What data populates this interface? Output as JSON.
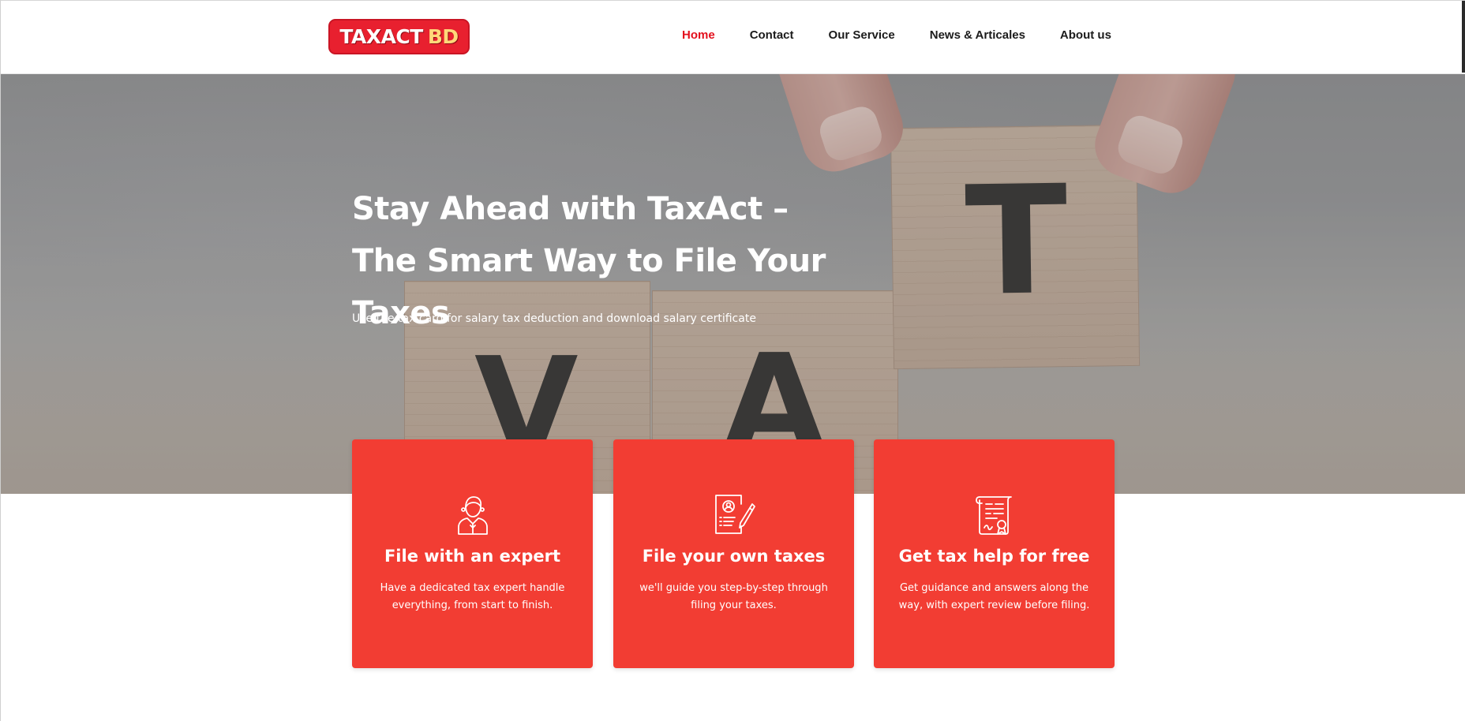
{
  "brand": {
    "logo_part1": "TAXACT",
    "logo_part2": "BD",
    "colors": {
      "primary": "#e8202f",
      "accent": "#ffd87a",
      "card": "#f23d33",
      "nav_active": "#e3101d"
    }
  },
  "nav": {
    "items": [
      {
        "label": "Home",
        "active": true
      },
      {
        "label": "Contact",
        "active": false
      },
      {
        "label": "Our Service",
        "active": false
      },
      {
        "label": "News & Articales",
        "active": false
      },
      {
        "label": "About us",
        "active": false
      }
    ]
  },
  "hero": {
    "title": "Stay Ahead with TaxAct – The Smart Way to File Your Taxes",
    "subtitle": "Use the tax card for salary tax deduction and download salary certificate",
    "image": {
      "block_letters": [
        "V",
        "A",
        "T"
      ]
    }
  },
  "services": [
    {
      "icon": "expert-person-icon",
      "title": "File with an expert",
      "description": "Have a dedicated tax expert handle everything, from start to finish."
    },
    {
      "icon": "document-pen-icon",
      "title": "File your own taxes",
      "description": "we'll guide you step-by-step through filing your taxes."
    },
    {
      "icon": "certificate-scroll-icon",
      "title": "Get tax help for free",
      "description": "Get guidance and answers along the way, with expert review before filing."
    }
  ]
}
